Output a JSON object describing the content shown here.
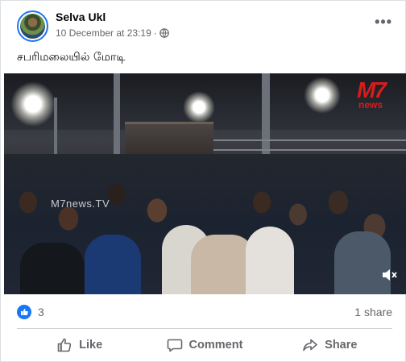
{
  "post": {
    "author": "Selva Ukl",
    "timestamp": "10 December at 23:19",
    "separator": "·",
    "privacy_icon": "globe-icon",
    "more_icon": "more-options-icon",
    "caption": "சபரிமலையில் மோடி"
  },
  "video": {
    "watermark_logo_main": "M7",
    "watermark_logo_sub": "news",
    "watermark_text": "M7news.TV",
    "volume_icon": "speaker-muted-icon"
  },
  "stats": {
    "reaction_icon": "like-reaction-icon",
    "reaction_count": "3",
    "shares": "1 share"
  },
  "actions": {
    "like_label": "Like",
    "comment_label": "Comment",
    "share_label": "Share"
  },
  "colors": {
    "accent": "#1877f2",
    "secondary_text": "#65676b",
    "watermark": "#d81c1c"
  }
}
